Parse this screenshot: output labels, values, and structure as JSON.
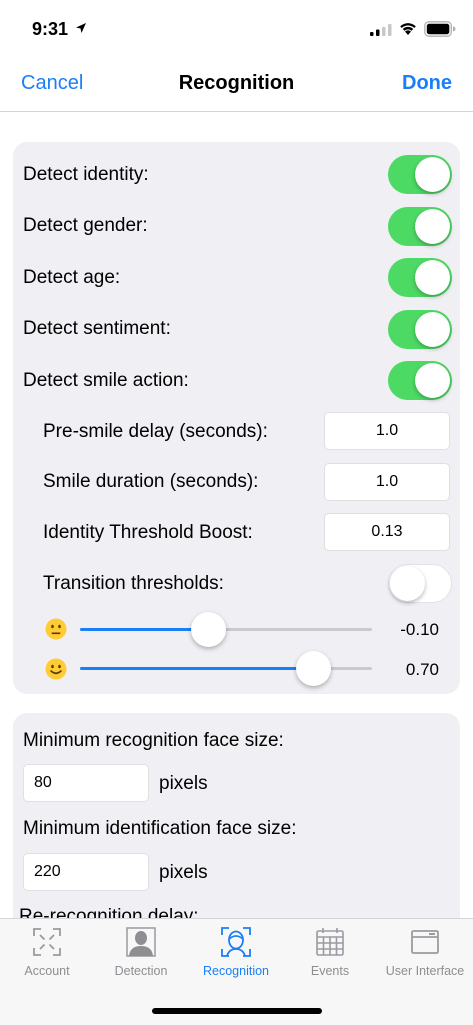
{
  "status": {
    "time": "9:31"
  },
  "nav": {
    "cancel": "Cancel",
    "title": "Recognition",
    "done": "Done"
  },
  "detection_toggles": [
    {
      "label": "Detect identity:",
      "on": true
    },
    {
      "label": "Detect gender:",
      "on": true
    },
    {
      "label": "Detect age:",
      "on": true
    },
    {
      "label": "Detect sentiment:",
      "on": true
    },
    {
      "label": "Detect smile action:",
      "on": true
    }
  ],
  "smile_settings": {
    "pre_smile_label": "Pre-smile delay (seconds):",
    "pre_smile_value": "1.0",
    "duration_label": "Smile duration (seconds):",
    "duration_value": "1.0",
    "boost_label": "Identity Threshold Boost:",
    "boost_value": "0.13",
    "transition_label": "Transition thresholds:",
    "transition_on": false
  },
  "sliders": [
    {
      "icon": "neutral-face-icon",
      "value": "-0.10",
      "fraction": 0.44
    },
    {
      "icon": "smiling-face-icon",
      "value": "0.70",
      "fraction": 0.8
    }
  ],
  "face_size": {
    "min_recognition_label": "Minimum recognition face size:",
    "min_recognition_value": "80",
    "min_recognition_unit": "pixels",
    "min_identification_label": "Minimum identification face size:",
    "min_identification_value": "220",
    "min_identification_unit": "pixels",
    "re_recognition_label": "Re-recognition delay:"
  },
  "tabs": [
    {
      "label": "Account",
      "icon": "account-frame-icon"
    },
    {
      "label": "Detection",
      "icon": "person-silhouette-icon"
    },
    {
      "label": "Recognition",
      "icon": "face-scan-icon",
      "active": true
    },
    {
      "label": "Events",
      "icon": "calendar-icon"
    },
    {
      "label": "User Interface",
      "icon": "window-icon"
    }
  ],
  "colors": {
    "accent": "#1a7ff6",
    "toggle_on": "#4cd964",
    "card_bg": "#efeff4"
  }
}
